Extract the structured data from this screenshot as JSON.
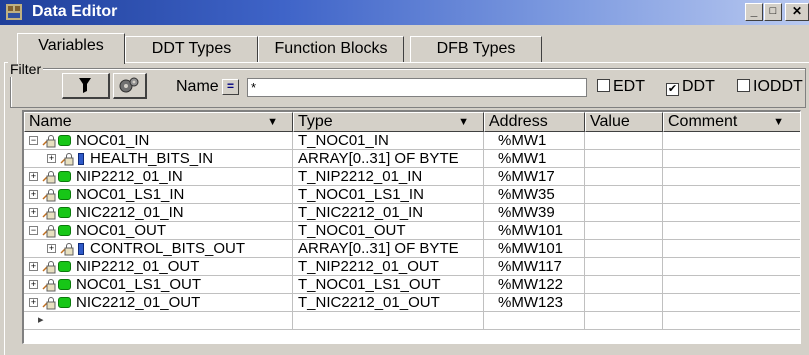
{
  "window": {
    "title": "Data Editor",
    "buttons": {
      "minimize": "_",
      "maximize": "□",
      "close": "✕"
    }
  },
  "tabs": [
    {
      "label": "Variables",
      "active": true
    },
    {
      "label": "DDT Types",
      "active": false
    },
    {
      "label": "Function Blocks",
      "active": false
    },
    {
      "label": "DFB Types",
      "active": false
    }
  ],
  "filter": {
    "legend": "Filter",
    "name_label": "Name",
    "eq_label": "=",
    "value": "*",
    "checkboxes": [
      {
        "label": "EDT",
        "checked": false
      },
      {
        "label": "DDT",
        "checked": true
      },
      {
        "label": "IODDT",
        "checked": false
      }
    ]
  },
  "columns": [
    {
      "label": "Name",
      "dropdown": true
    },
    {
      "label": "Type",
      "dropdown": true
    },
    {
      "label": "Address",
      "dropdown": false
    },
    {
      "label": "Value",
      "dropdown": false
    },
    {
      "label": "Comment",
      "dropdown": true
    }
  ],
  "rows": [
    {
      "name": "NOC01_IN",
      "type": "T_NOC01_IN",
      "address": "%MW1",
      "level": 0,
      "expander": "minus",
      "tag": "green"
    },
    {
      "name": "HEALTH_BITS_IN",
      "type": "ARRAY[0..31] OF BYTE",
      "address": "%MW1",
      "level": 1,
      "expander": "plus",
      "tag": "blue"
    },
    {
      "name": "NIP2212_01_IN",
      "type": "T_NIP2212_01_IN",
      "address": "%MW17",
      "level": 0,
      "expander": "plus",
      "tag": "green"
    },
    {
      "name": "NOC01_LS1_IN",
      "type": "T_NOC01_LS1_IN",
      "address": "%MW35",
      "level": 0,
      "expander": "plus",
      "tag": "green"
    },
    {
      "name": "NIC2212_01_IN",
      "type": "T_NIC2212_01_IN",
      "address": "%MW39",
      "level": 0,
      "expander": "plus",
      "tag": "green"
    },
    {
      "name": "NOC01_OUT",
      "type": "T_NOC01_OUT",
      "address": "%MW101",
      "level": 0,
      "expander": "minus",
      "tag": "green"
    },
    {
      "name": "CONTROL_BITS_OUT",
      "type": "ARRAY[0..31] OF BYTE",
      "address": "%MW101",
      "level": 1,
      "expander": "plus",
      "tag": "blue"
    },
    {
      "name": "NIP2212_01_OUT",
      "type": "T_NIP2212_01_OUT",
      "address": "%MW117",
      "level": 0,
      "expander": "plus",
      "tag": "green"
    },
    {
      "name": "NOC01_LS1_OUT",
      "type": "T_NOC01_LS1_OUT",
      "address": "%MW122",
      "level": 0,
      "expander": "plus",
      "tag": "green"
    },
    {
      "name": "NIC2212_01_OUT",
      "type": "T_NIC2212_01_OUT",
      "address": "%MW123",
      "level": 0,
      "expander": "plus",
      "tag": "green"
    }
  ],
  "new_row_marker": "▸",
  "colors": {
    "titlebar_start": "#1f3f9a",
    "titlebar_end": "#b9c9f0",
    "tag_green": "#17c617",
    "tag_blue": "#2f5ac8"
  }
}
